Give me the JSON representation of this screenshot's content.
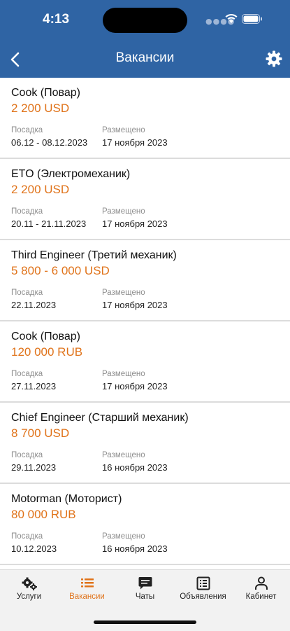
{
  "status_bar": {
    "time": "4:13"
  },
  "header": {
    "title": "Вакансии"
  },
  "labels": {
    "boarding": "Посадка",
    "posted": "Размещено"
  },
  "vacancies": [
    {
      "position": "Cook (Повар)",
      "salary": "2 200 USD",
      "boarding": "06.12 - 08.12.2023",
      "posted": "17 ноября 2023"
    },
    {
      "position": "ETO (Электромеханик)",
      "salary": "2 200 USD",
      "boarding": "20.11 - 21.11.2023",
      "posted": "17 ноября 2023"
    },
    {
      "position": "Third Engineer (Третий механик)",
      "salary": "5 800 - 6 000 USD",
      "boarding": "22.11.2023",
      "posted": "17 ноября 2023"
    },
    {
      "position": "Cook (Повар)",
      "salary": "120 000 RUB",
      "boarding": "27.11.2023",
      "posted": "17 ноября 2023"
    },
    {
      "position": "Chief Engineer (Старший механик)",
      "salary": "8 700 USD",
      "boarding": "29.11.2023",
      "posted": "16 ноября 2023"
    },
    {
      "position": "Motorman (Моторист)",
      "salary": "80 000 RUB",
      "boarding": "10.12.2023",
      "posted": "16 ноября 2023"
    }
  ],
  "tabs": [
    {
      "label": "Услуги",
      "icon": "gears-icon"
    },
    {
      "label": "Вакансии",
      "icon": "list-icon",
      "active": true
    },
    {
      "label": "Чаты",
      "icon": "chat-icon"
    },
    {
      "label": "Объявления",
      "icon": "newspaper-icon"
    },
    {
      "label": "Кабинет",
      "icon": "user-icon"
    }
  ],
  "colors": {
    "header": "#2f64a4",
    "accent": "#e0731a",
    "tabbar": "#f2f2f2"
  }
}
